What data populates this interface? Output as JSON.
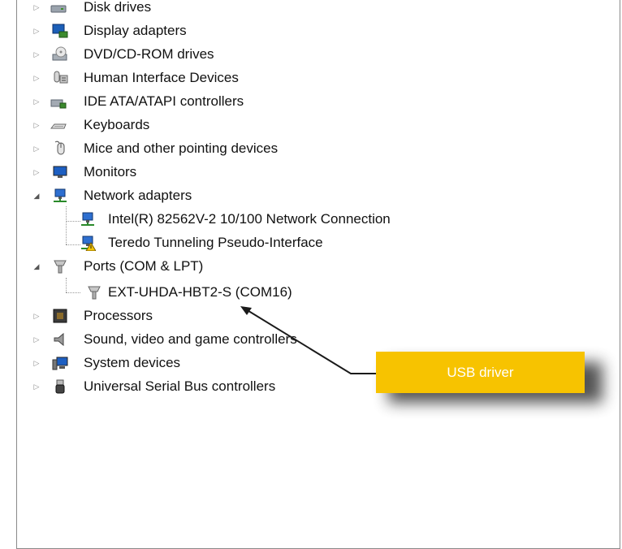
{
  "device_tree": {
    "categories": [
      {
        "label": "Disk drives",
        "icon": "disk-drive-icon",
        "expanded": false
      },
      {
        "label": "Display adapters",
        "icon": "display-adapter-icon",
        "expanded": false
      },
      {
        "label": "DVD/CD-ROM drives",
        "icon": "dvd-drive-icon",
        "expanded": false
      },
      {
        "label": "Human Interface Devices",
        "icon": "hid-icon",
        "expanded": false
      },
      {
        "label": "IDE ATA/ATAPI controllers",
        "icon": "ide-controller-icon",
        "expanded": false
      },
      {
        "label": "Keyboards",
        "icon": "keyboard-icon",
        "expanded": false
      },
      {
        "label": "Mice and other pointing devices",
        "icon": "mouse-icon",
        "expanded": false
      },
      {
        "label": "Monitors",
        "icon": "monitor-icon",
        "expanded": false
      },
      {
        "label": "Network adapters",
        "icon": "network-icon",
        "expanded": true
      },
      {
        "label": "Ports (COM & LPT)",
        "icon": "port-icon",
        "expanded": true
      },
      {
        "label": "Processors",
        "icon": "processor-icon",
        "expanded": false
      },
      {
        "label": "Sound, video and game controllers",
        "icon": "speaker-icon",
        "expanded": false
      },
      {
        "label": "System devices",
        "icon": "system-icon",
        "expanded": false
      },
      {
        "label": "Universal Serial Bus controllers",
        "icon": "usb-icon",
        "expanded": false
      }
    ],
    "network_children": [
      {
        "label": "Intel(R) 82562V-2 10/100 Network Connection",
        "icon": "network-icon"
      },
      {
        "label": "Teredo Tunneling Pseudo-Interface",
        "icon": "network-warning-icon"
      }
    ],
    "port_children": [
      {
        "label": "EXT-UHDA-HBT2-S (COM16)",
        "icon": "port-icon"
      }
    ]
  },
  "callout": {
    "text": "USB driver",
    "color": "#f7c300"
  }
}
